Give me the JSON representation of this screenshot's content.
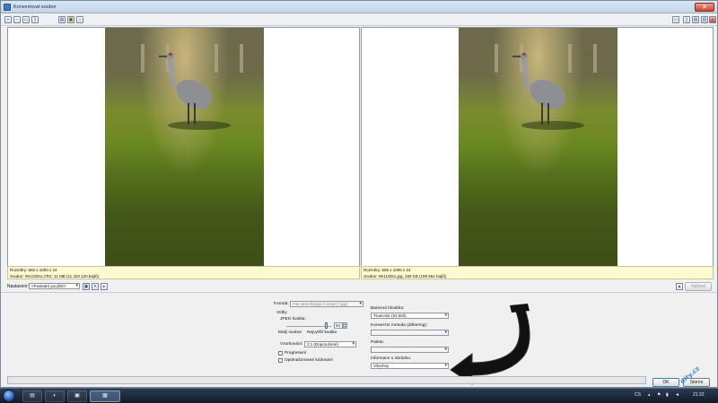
{
  "window": {
    "title": "Konvertovat soubor",
    "close_label": "✕"
  },
  "toolbar": {
    "buttons": [
      "zoom-in-icon",
      "zoom-out-icon",
      "fit-icon",
      "actual-size-icon",
      "open-folder-icon",
      "save-icon",
      "info-icon"
    ],
    "glyphs": [
      "+",
      "−",
      "▭",
      "1",
      "▤",
      "▣",
      "i"
    ],
    "right_buttons": [
      "layout-single-icon",
      "layout-split-icon",
      "layout-horizontal-icon",
      "layout-vertical-icon",
      "close-preview-icon"
    ],
    "right_glyphs": [
      "▭",
      "▯",
      "▤",
      "▥",
      "▪"
    ]
  },
  "left_info": {
    "line1": "Rozměry: 665 x 1000 x 24",
    "line2": "Soubor: 9K1I3251.CR2, 11 MB (11 423 120 bajtů)"
  },
  "right_info": {
    "line1": "Rozměry: 665 x 1000 x 24",
    "line2": "Soubor: 9K1I3251.jpg, 185 KB (189 562 bajtů)"
  },
  "settings": {
    "label": "Nastavení:",
    "preset": "<Poslední použité>",
    "preview_label": "Náhled"
  },
  "options": {
    "format_label": "Formát:",
    "format_value": "File Interchange Format (*.jpg)",
    "group_label": "Volby",
    "quality_label": "JPEG kvalita:",
    "quality_value": "94",
    "small_label": "Malý soubor",
    "best_label": "Nejvyšší kvalita",
    "sampling_label": "Vzorkování:",
    "sampling_value": "2:1 (Doporučené)",
    "progressive_label": "Progresivní",
    "optimized_label": "Optimalizované kódování",
    "color_depth_label": "Barevná hloubka:",
    "color_depth_value": "Truecolor (24 bitů)",
    "conversion_label": "Konverzní metoda (dithering):",
    "conversion_value": "",
    "palette_label": "Paleta:",
    "palette_value": "",
    "image_info_label": "Informace o obrázku:",
    "image_info_value": "Všechny"
  },
  "actions": {
    "ok": "OK",
    "cancel": "Storno"
  },
  "taskbar": {
    "lang": "CS",
    "time": "21:22"
  },
  "watermark": "dity.cz",
  "colors": {
    "info_bg": "#fffbd0",
    "arrow": "#111111"
  }
}
